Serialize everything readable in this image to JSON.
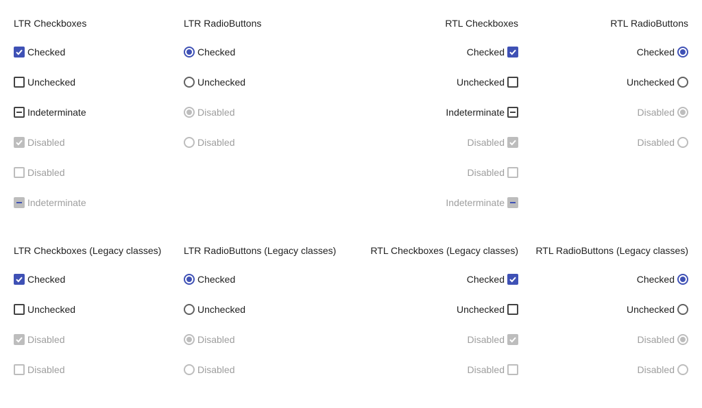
{
  "colors": {
    "accent": "#3f51b5",
    "disabled": "#bdbdbd",
    "text": "#212121",
    "disabled_text": "#9e9e9e"
  },
  "sections": [
    {
      "columns": [
        {
          "title": "LTR Checkboxes",
          "dir": "ltr",
          "kind": "checkbox",
          "items": [
            {
              "label": "Checked",
              "state": "checked",
              "disabled": false
            },
            {
              "label": "Unchecked",
              "state": "unchecked",
              "disabled": false
            },
            {
              "label": "Indeterminate",
              "state": "indeterminate",
              "disabled": false
            },
            {
              "label": "Disabled",
              "state": "checked",
              "disabled": true
            },
            {
              "label": "Disabled",
              "state": "unchecked",
              "disabled": true
            },
            {
              "label": "Indeterminate",
              "state": "indeterminate",
              "disabled": true
            }
          ]
        },
        {
          "title": "LTR RadioButtons",
          "dir": "ltr",
          "kind": "radio",
          "items": [
            {
              "label": "Checked",
              "state": "checked",
              "disabled": false
            },
            {
              "label": "Unchecked",
              "state": "unchecked",
              "disabled": false
            },
            {
              "label": "Disabled",
              "state": "checked",
              "disabled": true
            },
            {
              "label": "Disabled",
              "state": "unchecked",
              "disabled": true
            }
          ]
        },
        {
          "title": "RTL Checkboxes",
          "dir": "rtl",
          "kind": "checkbox",
          "items": [
            {
              "label": "Checked",
              "state": "checked",
              "disabled": false
            },
            {
              "label": "Unchecked",
              "state": "unchecked",
              "disabled": false
            },
            {
              "label": "Indeterminate",
              "state": "indeterminate",
              "disabled": false
            },
            {
              "label": "Disabled",
              "state": "checked",
              "disabled": true
            },
            {
              "label": "Disabled",
              "state": "unchecked",
              "disabled": true
            },
            {
              "label": "Indeterminate",
              "state": "indeterminate",
              "disabled": true
            }
          ]
        },
        {
          "title": "RTL RadioButtons",
          "dir": "rtl",
          "kind": "radio",
          "items": [
            {
              "label": "Checked",
              "state": "checked",
              "disabled": false
            },
            {
              "label": "Unchecked",
              "state": "unchecked",
              "disabled": false
            },
            {
              "label": "Disabled",
              "state": "checked",
              "disabled": true
            },
            {
              "label": "Disabled",
              "state": "unchecked",
              "disabled": true
            }
          ]
        }
      ]
    },
    {
      "columns": [
        {
          "title": "LTR Checkboxes (Legacy classes)",
          "dir": "ltr",
          "kind": "checkbox",
          "items": [
            {
              "label": "Checked",
              "state": "checked",
              "disabled": false
            },
            {
              "label": "Unchecked",
              "state": "unchecked",
              "disabled": false
            },
            {
              "label": "Disabled",
              "state": "checked",
              "disabled": true
            },
            {
              "label": "Disabled",
              "state": "unchecked",
              "disabled": true
            }
          ]
        },
        {
          "title": "LTR RadioButtons (Legacy classes)",
          "dir": "ltr",
          "kind": "radio",
          "items": [
            {
              "label": "Checked",
              "state": "checked",
              "disabled": false
            },
            {
              "label": "Unchecked",
              "state": "unchecked",
              "disabled": false
            },
            {
              "label": "Disabled",
              "state": "checked",
              "disabled": true
            },
            {
              "label": "Disabled",
              "state": "unchecked",
              "disabled": true
            }
          ]
        },
        {
          "title": "RTL Checkboxes (Legacy classes)",
          "dir": "rtl",
          "kind": "checkbox",
          "items": [
            {
              "label": "Checked",
              "state": "checked",
              "disabled": false
            },
            {
              "label": "Unchecked",
              "state": "unchecked",
              "disabled": false
            },
            {
              "label": "Disabled",
              "state": "checked",
              "disabled": true
            },
            {
              "label": "Disabled",
              "state": "unchecked",
              "disabled": true
            }
          ]
        },
        {
          "title": "RTL RadioButtons (Legacy classes)",
          "dir": "rtl",
          "kind": "radio",
          "items": [
            {
              "label": "Checked",
              "state": "checked",
              "disabled": false
            },
            {
              "label": "Unchecked",
              "state": "unchecked",
              "disabled": false
            },
            {
              "label": "Disabled",
              "state": "checked",
              "disabled": true
            },
            {
              "label": "Disabled",
              "state": "unchecked",
              "disabled": true
            }
          ]
        }
      ]
    }
  ]
}
